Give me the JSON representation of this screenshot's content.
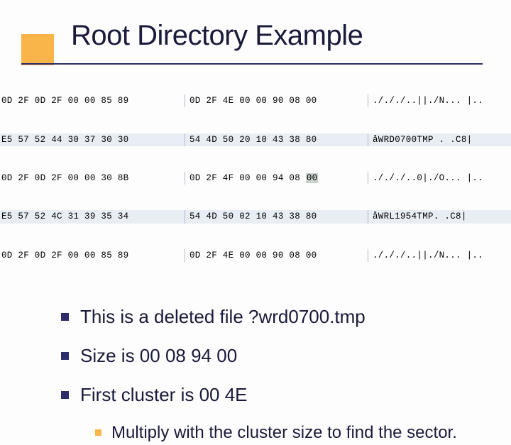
{
  "title": "Root Directory Example",
  "hexdump": {
    "rows": [
      {
        "a": "0D 2F 0D 2F 00 00 85 89",
        "b": "0D 2F 4E 00 00 90 08 00",
        "ascii": "./././..||./N... |..",
        "hl": false
      },
      {
        "a": "E5 57 52 44 30 37 30 30",
        "b": "54 4D 50 20 10 43 38 80",
        "ascii": "åWRD0700TMP . .C8|",
        "hl": true
      },
      {
        "a": "0D 2F 0D 2F 00 00 30 8B",
        "b": "0D 2F 4F 00 00 94 08 ",
        "ascii": "./././..0|./O... |..",
        "hl": false,
        "hlByte": "00"
      },
      {
        "a": "E5 57 52 4C 31 39 35 34",
        "b": "54 4D 50 02 10 43 38 80",
        "ascii": "åWRL1954TMP. .C8|",
        "hl": true
      },
      {
        "a": "0D 2F 0D 2F 00 00 85 89",
        "b": "0D 2F 4E 00 00 90 08 00",
        "ascii": "./././..||./N... |..",
        "hl": false
      }
    ]
  },
  "bullets": [
    "This is a deleted file ?wrd0700.tmp",
    "Size is 00 08 94 00",
    "First cluster is 00 4E"
  ],
  "subBullets": [
    "Multiply with the cluster size to find the sector."
  ]
}
